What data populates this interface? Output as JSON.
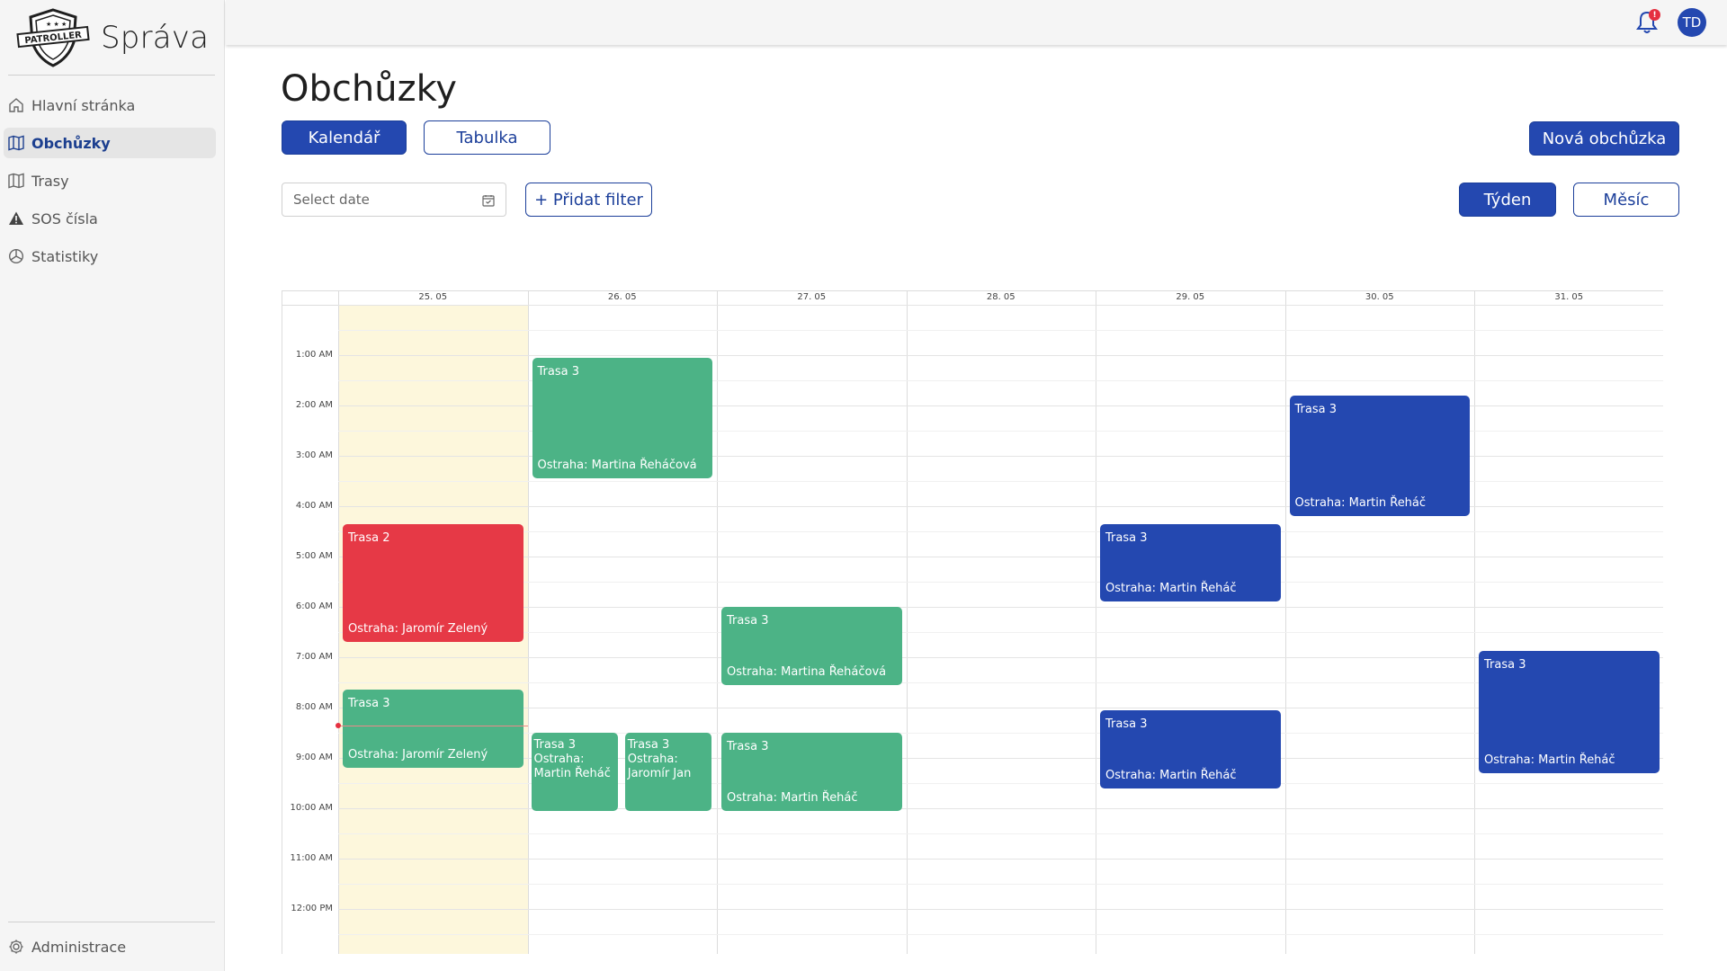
{
  "sidebar": {
    "logo_text": "PATROLLER",
    "brand": "Správa",
    "items": [
      {
        "label": "Hlavní stránka"
      },
      {
        "label": "Obchůzky"
      },
      {
        "label": "Trasy"
      },
      {
        "label": "SOS čísla"
      },
      {
        "label": "Statistiky"
      }
    ],
    "admin_label": "Administrace"
  },
  "topbar": {
    "notification_count": "!",
    "avatar_initials": "TD"
  },
  "page": {
    "title": "Obchůzky",
    "view_calendar": "Kalendář",
    "view_table": "Tabulka",
    "new_button": "Nová obchůzka",
    "date_placeholder": "Select date",
    "add_filter": "+ Přidat filter",
    "week": "Týden",
    "month": "Měsíc"
  },
  "calendar": {
    "days": [
      "25. 05",
      "26. 05",
      "27. 05",
      "28. 05",
      "29. 05",
      "30. 05",
      "31. 05"
    ],
    "times": [
      "1:00 AM",
      "2:00 AM",
      "3:00 AM",
      "4:00 AM",
      "5:00 AM",
      "6:00 AM",
      "7:00 AM",
      "8:00 AM",
      "9:00 AM",
      "10:00 AM",
      "11:00 AM",
      "12:00 PM"
    ],
    "events": [
      {
        "day": 1,
        "start": 1.05,
        "end": 3.45,
        "title": "Trasa 3",
        "guard": "Ostraha: Martina Řeháčová",
        "color": "#4cb386"
      },
      {
        "day": 5,
        "start": 1.8,
        "end": 4.2,
        "title": "Trasa 3",
        "guard": "Ostraha: Martin Řeháč",
        "color": "#2448b0"
      },
      {
        "day": 0,
        "start": 4.35,
        "end": 6.7,
        "title": "Trasa 2",
        "guard": "Ostraha: Jaromír Zelený",
        "color": "#e63946"
      },
      {
        "day": 4,
        "start": 4.35,
        "end": 5.9,
        "title": "Trasa 3",
        "guard": "Ostraha: Martin Řeháč",
        "color": "#2448b0"
      },
      {
        "day": 2,
        "start": 6.0,
        "end": 7.55,
        "title": "Trasa 3",
        "guard": "Ostraha: Martina Řeháčová",
        "color": "#4cb386"
      },
      {
        "day": 6,
        "start": 6.87,
        "end": 9.3,
        "title": "Trasa 3",
        "guard": "Ostraha: Martin Řeháč",
        "color": "#2448b0"
      },
      {
        "day": 0,
        "start": 7.65,
        "end": 9.2,
        "title": "Trasa 3",
        "guard": "Ostraha: Jaromír Zelený",
        "color": "#4cb386"
      },
      {
        "day": 4,
        "start": 8.05,
        "end": 9.6,
        "title": "Trasa 3",
        "guard": "Ostraha: Martin Řeháč",
        "color": "#2448b0"
      },
      {
        "day": 1,
        "start": 8.5,
        "end": 10.05,
        "title": "Trasa 3",
        "guard": "Ostraha: Martin Řeháč",
        "color": "#4cb386",
        "sub": 0,
        "stack": true
      },
      {
        "day": 1,
        "start": 8.5,
        "end": 10.05,
        "title": "Trasa 3",
        "guard": "Ostraha: Jaromír Jan",
        "color": "#4cb386",
        "sub": 1,
        "stack": true
      },
      {
        "day": 2,
        "start": 8.5,
        "end": 10.05,
        "title": "Trasa 3",
        "guard": "Ostraha: Martin Řeháč",
        "color": "#4cb386"
      }
    ],
    "now_hour": 8.35
  },
  "colors": {
    "primary": "#2448b0",
    "green": "#4cb386",
    "red": "#e63946",
    "today": "#fdf7dc"
  }
}
